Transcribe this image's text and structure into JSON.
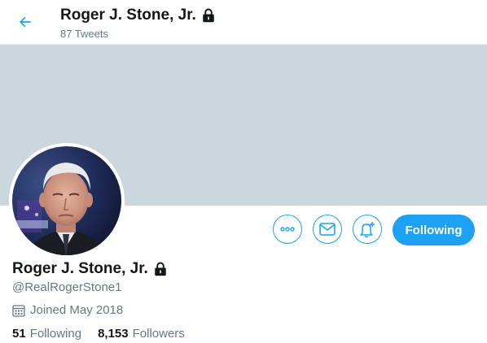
{
  "header": {
    "name": "Roger J. Stone, Jr.",
    "tweet_count": "87 Tweets",
    "back_icon": "arrow-left-icon"
  },
  "actions": {
    "more_icon": "more-icon",
    "message_icon": "envelope-icon",
    "notify_icon": "bell-plus-icon",
    "follow_label": "Following"
  },
  "profile": {
    "name": "Roger J. Stone, Jr.",
    "handle": "@RealRogerStone1",
    "joined": "Joined May 2018",
    "protected_icon": "lock-icon",
    "calendar_icon": "calendar-icon"
  },
  "stats": {
    "following_count": "51",
    "following_label": "Following",
    "followers_count": "8,153",
    "followers_label": "Followers"
  },
  "colors": {
    "accent": "#1da1f2",
    "banner": "#ccd6dd",
    "secondary_text": "#657786",
    "primary_text": "#14171a"
  }
}
